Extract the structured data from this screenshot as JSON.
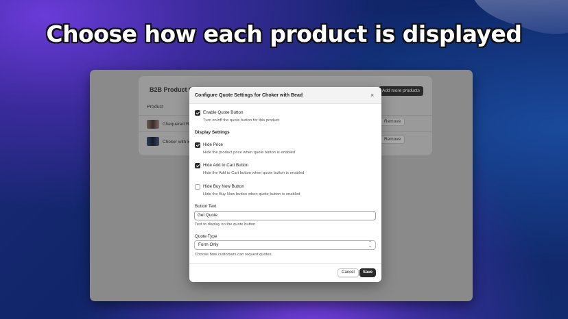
{
  "headline": "Choose how each product is displayed",
  "background_page": {
    "title": "B2B Product Quo",
    "add_button": "Add more products",
    "column_header": "Product",
    "rows": [
      {
        "name": "Chequered Re",
        "action": "Remove"
      },
      {
        "name": "Choker with B",
        "action": "Remove"
      }
    ]
  },
  "modal": {
    "title": "Configure Quote Settings for Choker with Bead",
    "close_icon": "×",
    "enable_quote": {
      "label": "Enable Quote Button",
      "help": "Turn on/off the quote button for this product",
      "checked": true
    },
    "display_settings_heading": "Display Settings",
    "options": [
      {
        "label": "Hide Price",
        "help": "Hide the product price when quote button is enabled",
        "checked": true
      },
      {
        "label": "Hide Add to Cart Button",
        "help": "Hide the Add to Cart button when quote button is enabled",
        "checked": true
      },
      {
        "label": "Hide Buy Now Button",
        "help": "Hide the Buy Now button when quote button is enabled",
        "checked": false
      }
    ],
    "button_text": {
      "label": "Button Text",
      "value": "Get Quote",
      "help": "Text to display on the quote button"
    },
    "quote_type": {
      "label": "Quote Type",
      "value": "Form Only",
      "help": "Choose how customers can request quotes"
    },
    "cancel_label": "Cancel",
    "save_label": "Save"
  }
}
